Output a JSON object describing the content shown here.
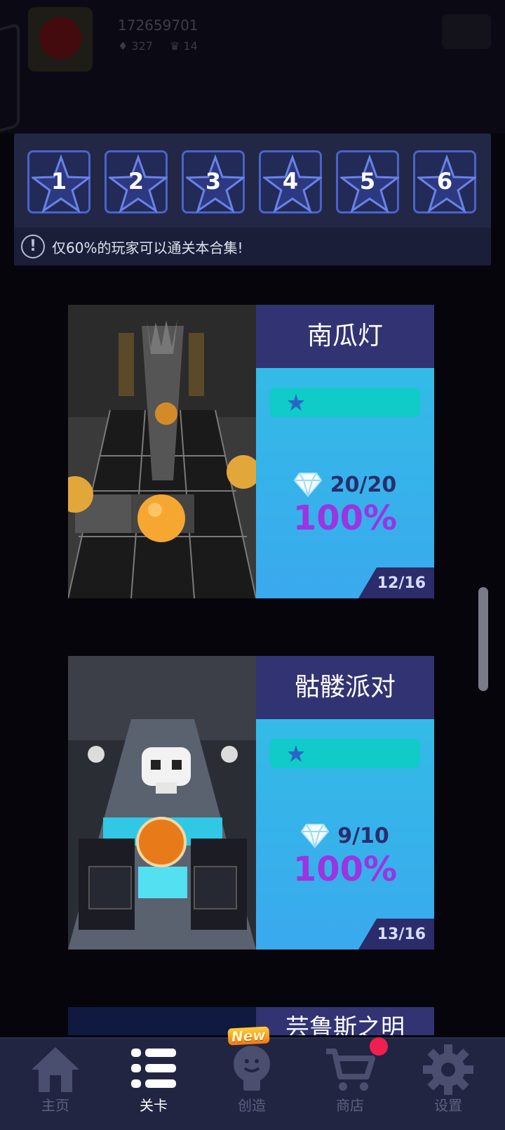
{
  "header": {
    "player_id": "172659701",
    "gems": "327",
    "crowns": "14"
  },
  "stages": [
    "1",
    "2",
    "3",
    "4",
    "5",
    "6"
  ],
  "notice": {
    "icon": "info-icon",
    "text": "仅60%的玩家可以通关本合集!"
  },
  "levels": [
    {
      "title": "南瓜灯",
      "gems": "20/20",
      "percent": "100%",
      "progress": "12/16",
      "stars": 1
    },
    {
      "title": "骷髅派对",
      "gems": "9/10",
      "percent": "100%",
      "progress": "13/16",
      "stars": 1
    },
    {
      "title": "芸鲁斯之明"
    }
  ],
  "nav": {
    "items": [
      {
        "label": "主页",
        "icon": "home-icon"
      },
      {
        "label": "关卡",
        "icon": "list-icon"
      },
      {
        "label": "创造",
        "icon": "bulb-icon"
      },
      {
        "label": "商店",
        "icon": "cart-icon"
      },
      {
        "label": "设置",
        "icon": "gear-icon"
      }
    ],
    "new_badge": "New",
    "active_index": 1
  },
  "colors": {
    "accent_purple": "#9a35e0",
    "card_header": "#313373",
    "panel": "#222745",
    "nav_bg": "#222542"
  }
}
